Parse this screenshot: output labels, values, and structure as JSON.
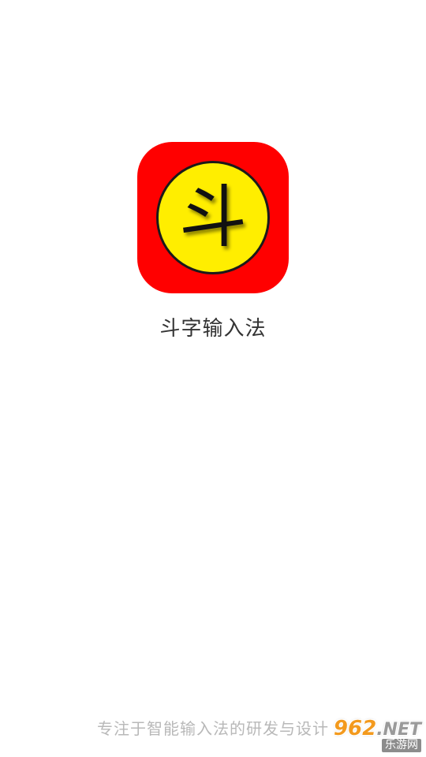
{
  "app": {
    "icon_glyph": "斗",
    "name": "斗字输入法",
    "slogan": "专注于智能输入法的研发与设计",
    "colors": {
      "icon_background": "#ff0000",
      "coin_fill": "#ffee00",
      "name_text": "#333333",
      "slogan_text": "#b8b8b8"
    }
  },
  "watermark": {
    "brand_number": "962",
    "brand_suffix": ".NET",
    "brand_tagline": "乐游网",
    "colors": {
      "number": "#f39a1e",
      "suffix": "#9a9a9a"
    }
  }
}
